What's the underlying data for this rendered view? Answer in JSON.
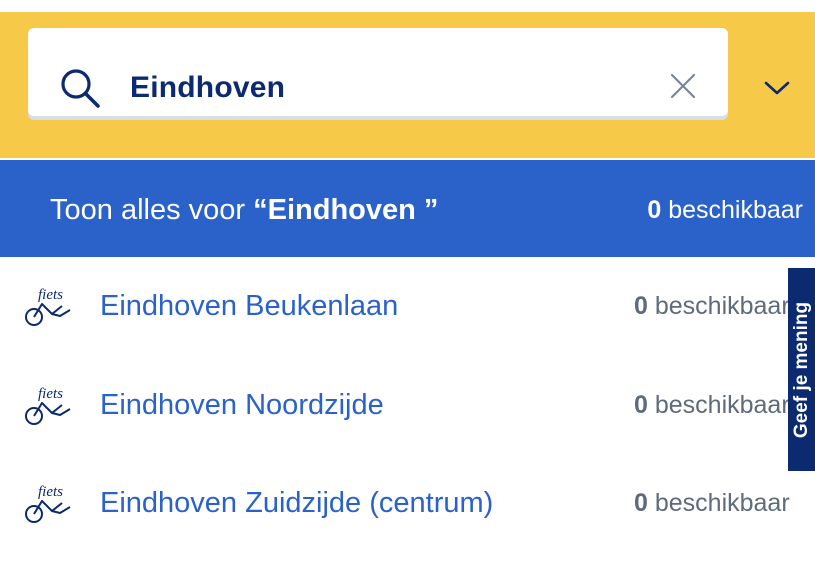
{
  "search": {
    "value": "Eindhoven",
    "icon": "search-icon",
    "clear_icon": "close-icon",
    "expand_icon": "chevron-down-icon"
  },
  "show_all": {
    "prefix": "Toon alles voor ",
    "query": "“Eindhoven ”",
    "count": "0",
    "available_label": " beschikbaar"
  },
  "results": [
    {
      "brand": "fiets",
      "name": "Eindhoven Beukenlaan",
      "count": "0",
      "available_label": " beschikbaar"
    },
    {
      "brand": "fiets",
      "name": "Eindhoven Noordzijde",
      "count": "0",
      "available_label": " beschikbaar"
    },
    {
      "brand": "fiets",
      "name": "Eindhoven Zuidzijde (centrum)",
      "count": "0",
      "available_label": " beschikbaar"
    }
  ],
  "feedback": {
    "label": "Geef je mening"
  },
  "colors": {
    "header": "#f7c948",
    "primary": "#2a62c9",
    "navy": "#0b2a6f",
    "muted": "#5f6b7a"
  }
}
